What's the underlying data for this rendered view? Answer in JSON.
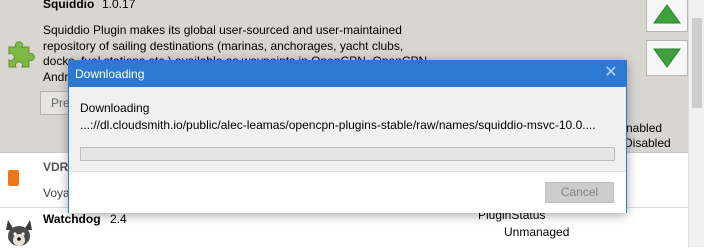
{
  "plugins": [
    {
      "name": "Squiddio",
      "version": "1.0.17",
      "description_lines": [
        "Squiddio Plugin makes its global user-sourced and user-maintained",
        "repository of sailing destinations (marinas, anchorages, yacht clubs,",
        "docks, fuel stations etc.) available as waypoints in OpenCPN. OpenCPN",
        "Andr"
      ],
      "button_fragment": "Pre",
      "status_fragment_1": "nabled",
      "status_fragment_2": "Disabled"
    },
    {
      "name": "VDR",
      "description_fragment": "Voya"
    },
    {
      "name": "Watchdog",
      "version": "2.4",
      "status_label": "PluginStatus",
      "status_value": "Unmanaged"
    }
  ],
  "dialog": {
    "title": "Downloading",
    "close_glyph": "✕",
    "label": "Downloading",
    "url": "...://dl.cloudsmith.io/public/alec-leamas/opencpn-plugins-stable/raw/names/squiddio-msvc-10.0....",
    "progress": 0,
    "cancel_label": "Cancel"
  },
  "colors": {
    "accent": "#2b79d0",
    "selected_row": "#d9d5d0",
    "arrow_green": "#3da23d"
  },
  "icons": [
    "puzzle-piece-icon",
    "arrow-up-icon",
    "arrow-down-icon",
    "vdr-icon",
    "watchdog-dog-icon",
    "close-icon"
  ]
}
